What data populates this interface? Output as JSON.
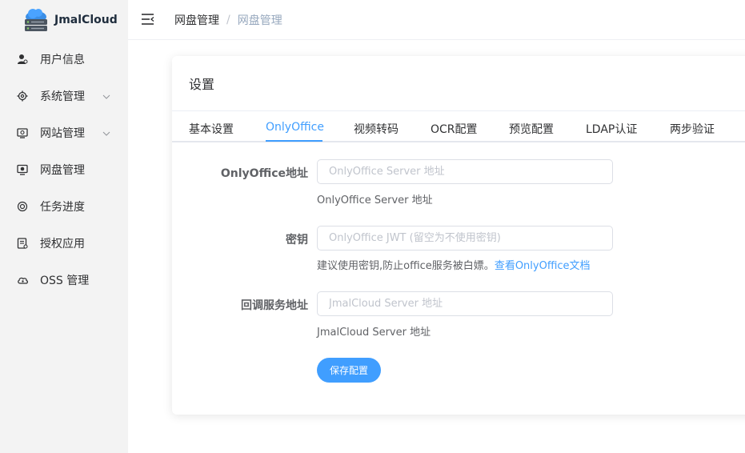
{
  "app": {
    "name": "JmalCloud"
  },
  "sidebar": {
    "items": [
      {
        "label": "用户信息",
        "icon": "user-icon",
        "has_submenu": false
      },
      {
        "label": "系统管理",
        "icon": "gear-icon",
        "has_submenu": true
      },
      {
        "label": "网站管理",
        "icon": "website-icon",
        "has_submenu": true
      },
      {
        "label": "网盘管理",
        "icon": "disk-icon",
        "has_submenu": false
      },
      {
        "label": "任务进度",
        "icon": "progress-icon",
        "has_submenu": false
      },
      {
        "label": "授权应用",
        "icon": "authorization-icon",
        "has_submenu": false
      },
      {
        "label": "OSS 管理",
        "icon": "cloud-icon",
        "has_submenu": false
      }
    ]
  },
  "header": {
    "breadcrumb": [
      "网盘管理",
      "网盘管理"
    ],
    "separator": "/"
  },
  "card": {
    "title": "设置",
    "tabs": [
      {
        "label": "基本设置",
        "active": false
      },
      {
        "label": "OnlyOffice",
        "active": true
      },
      {
        "label": "视频转码",
        "active": false
      },
      {
        "label": "OCR配置",
        "active": false
      },
      {
        "label": "预览配置",
        "active": false
      },
      {
        "label": "LDAP认证",
        "active": false
      },
      {
        "label": "两步验证",
        "active": false
      }
    ]
  },
  "form": {
    "onlyoffice_url": {
      "label": "OnlyOffice地址",
      "value": "",
      "placeholder": "OnlyOffice Server 地址",
      "hint": "OnlyOffice Server 地址"
    },
    "secret": {
      "label": "密钥",
      "value": "",
      "placeholder": "OnlyOffice JWT (留空为不使用密钥)",
      "hint": "建议使用密钥,防止office服务被白嫖。",
      "hint_link": "查看OnlyOffice文档"
    },
    "callback_url": {
      "label": "回调服务地址",
      "value": "",
      "placeholder": "JmalCloud Server 地址",
      "hint": "JmalCloud Server 地址"
    },
    "save_label": "保存配置"
  },
  "colors": {
    "primary": "#409eff",
    "sidebar_bg": "#f3f3f3",
    "text": "#303133",
    "breadcrumb_muted": "#97a8be"
  }
}
